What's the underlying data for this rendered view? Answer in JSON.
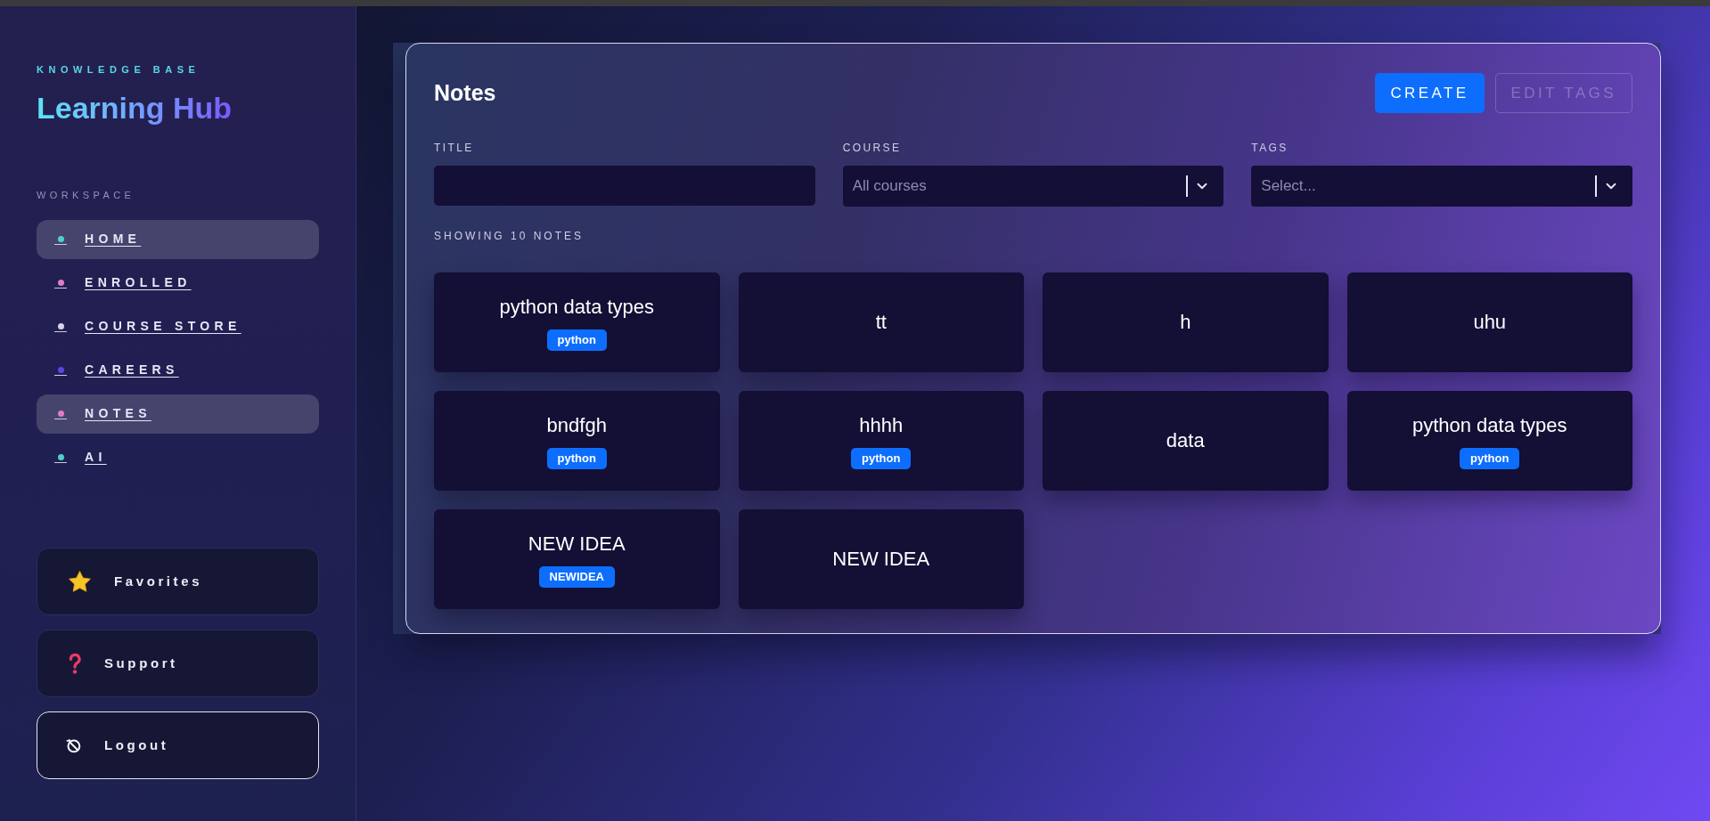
{
  "sidebar": {
    "eyebrow": "KNOWLEDGE BASE",
    "title": "Learning Hub",
    "section_label": "WORKSPACE",
    "nav_items": [
      {
        "label": "HOME",
        "selected": true,
        "color": "#4fd1c5"
      },
      {
        "label": "ENROLLED",
        "selected": false,
        "color": "#e27bc4"
      },
      {
        "label": "COURSE STORE",
        "selected": false,
        "color": "#d9cfe6"
      },
      {
        "label": "CAREERS",
        "selected": false,
        "color": "#5b46e0"
      },
      {
        "label": "NOTES",
        "selected": true,
        "color": "#e27bc4"
      },
      {
        "label": "AI",
        "selected": false,
        "color": "#4fd1c5"
      }
    ],
    "actions": [
      {
        "label": "Favorites",
        "kind": "favorites"
      },
      {
        "label": "Support",
        "kind": "support"
      },
      {
        "label": "Logout",
        "kind": "logout"
      }
    ]
  },
  "notes_panel": {
    "title": "Notes",
    "buttons": [
      {
        "label": "CREATE",
        "disabled": false
      },
      {
        "label": "EDIT TAGS",
        "disabled": true
      }
    ],
    "filters": [
      {
        "label": "TITLE",
        "kind": "text"
      },
      {
        "label": "COURSE",
        "kind": "select",
        "placeholder": "All courses"
      },
      {
        "label": "TAGS",
        "kind": "select",
        "placeholder": "Select..."
      }
    ],
    "count_label": "SHOWING 10 NOTES",
    "notes": [
      {
        "title": "python data types",
        "tags": [
          "python"
        ]
      },
      {
        "title": "tt"
      },
      {
        "title": "h"
      },
      {
        "title": "uhu"
      },
      {
        "title": "bndfgh",
        "tags": [
          "python"
        ]
      },
      {
        "title": "hhhh",
        "tags": [
          "python"
        ]
      },
      {
        "title": "data"
      },
      {
        "title": "python data types",
        "tags": [
          "python"
        ]
      },
      {
        "title": "NEW IDEA",
        "tags": [
          "NEWIDEA"
        ]
      },
      {
        "title": "NEW IDEA"
      }
    ]
  }
}
